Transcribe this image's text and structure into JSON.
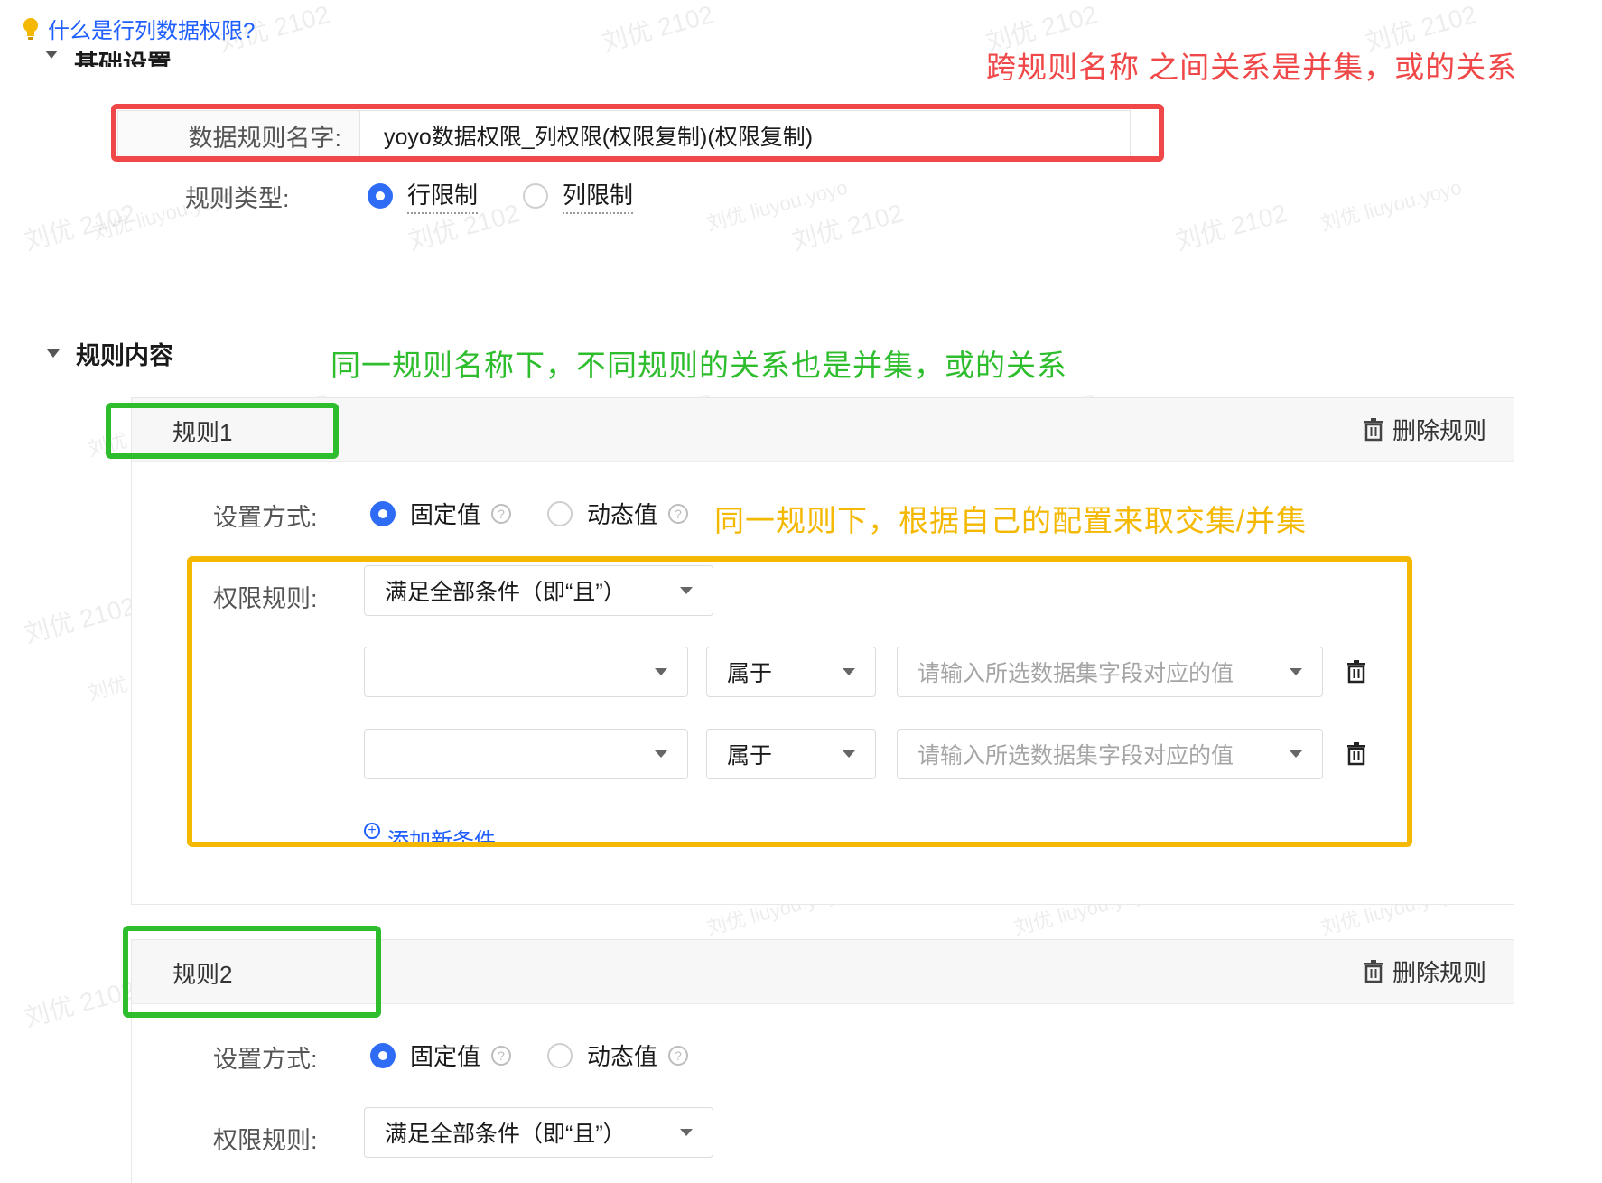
{
  "help": {
    "link_text": "什么是行列数据权限?"
  },
  "basic": {
    "section_title": "基础设置",
    "name_label": "数据规则名字:",
    "name_value": "yoyo数据权限_列权限(权限复制)(权限复制)",
    "type_label": "规则类型:",
    "type_options": [
      "行限制",
      "列限制"
    ],
    "type_selected": "行限制"
  },
  "content": {
    "section_title": "规则内容",
    "rules": [
      {
        "title": "规则1",
        "delete_label": "删除规则",
        "mode_label": "设置方式:",
        "mode_options": [
          "固定值",
          "动态值"
        ],
        "mode_selected": "固定值",
        "perm_label": "权限规则:",
        "perm_value": "满足全部条件（即“且”）",
        "conditions": [
          {
            "field": "",
            "operator": "属于",
            "value_placeholder": "请输入所选数据集字段对应的值"
          },
          {
            "field": "",
            "operator": "属于",
            "value_placeholder": "请输入所选数据集字段对应的值"
          }
        ],
        "add_condition": "添加新条件"
      },
      {
        "title": "规则2",
        "delete_label": "删除规则",
        "mode_label": "设置方式:",
        "mode_options": [
          "固定值",
          "动态值"
        ],
        "mode_selected": "固定值",
        "perm_label": "权限规则:",
        "perm_value": "满足全部条件（即“且”）"
      }
    ]
  },
  "annotations": {
    "red": "跨规则名称 之间关系是并集，或的关系",
    "green": "同一规则名称下，不同规则的关系也是并集，或的关系",
    "yellow": "同一规则下，根据自己的配置来取交集/并集",
    "colors": {
      "red": "#f04848",
      "green": "#2dbd2d",
      "yellow": "#f5b800"
    }
  },
  "watermarks": {
    "name": "刘优 2102",
    "account": "刘优 liuyou.yoyo"
  },
  "colors": {
    "accent": "#2f6cf5",
    "link": "#1f5eff"
  }
}
